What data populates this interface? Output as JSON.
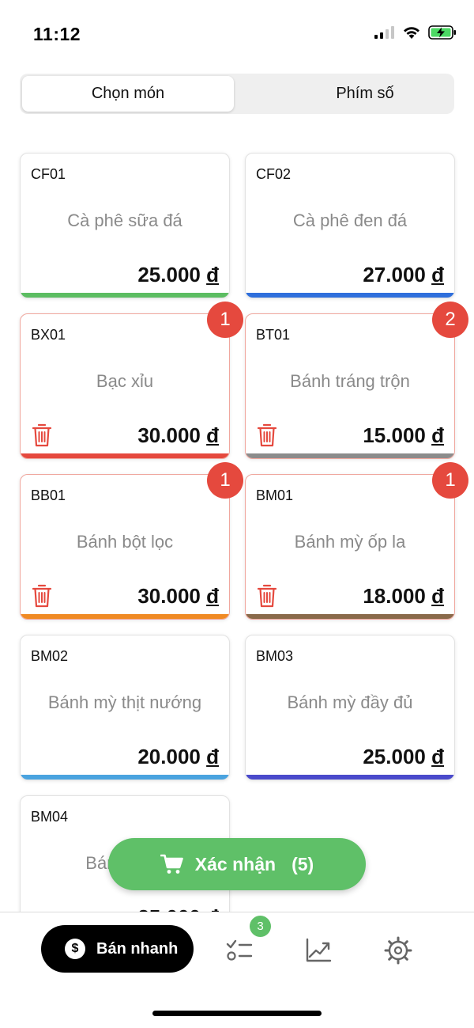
{
  "status_bar": {
    "time": "11:12"
  },
  "tabs": {
    "pick_item": "Chọn món",
    "numpad": "Phím số"
  },
  "products": [
    {
      "code": "CF01",
      "name": "Cà phê sữa đá",
      "price": "25.000",
      "currency": "đ",
      "bar_color": "#5cbd62",
      "qty": null
    },
    {
      "code": "CF02",
      "name": "Cà phê đen đá",
      "price": "27.000",
      "currency": "đ",
      "bar_color": "#2f6fdc",
      "qty": null
    },
    {
      "code": "BX01",
      "name": "Bạc xỉu",
      "price": "30.000",
      "currency": "đ",
      "bar_color": "#e5493e",
      "qty": "1"
    },
    {
      "code": "BT01",
      "name": "Bánh tráng trộn",
      "price": "15.000",
      "currency": "đ",
      "bar_color": "#8c8c8c",
      "qty": "2"
    },
    {
      "code": "BB01",
      "name": "Bánh bột lọc",
      "price": "30.000",
      "currency": "đ",
      "bar_color": "#f08a24",
      "qty": "1"
    },
    {
      "code": "BM01",
      "name": "Bánh mỳ ốp la",
      "price": "18.000",
      "currency": "đ",
      "bar_color": "#8a6a4a",
      "qty": "1"
    },
    {
      "code": "BM02",
      "name": "Bánh mỳ thịt nướng",
      "price": "20.000",
      "currency": "đ",
      "bar_color": "#4aa3df",
      "qty": null
    },
    {
      "code": "BM03",
      "name": "Bánh mỳ đầy đủ",
      "price": "25.000",
      "currency": "đ",
      "bar_color": "#4a4acb",
      "qty": null
    },
    {
      "code": "BM04",
      "name": "Bánh",
      "price": "25.000",
      "currency": "đ",
      "bar_color": "#e0e0e0",
      "qty": null
    }
  ],
  "confirm": {
    "label": "Xác nhận",
    "count": "(5)"
  },
  "nav": {
    "quick_sale": "Bán nhanh",
    "currency_symbol": "$",
    "orders_badge": "3"
  },
  "colors": {
    "accent_green": "#5fc068",
    "badge_red": "#e5493e"
  }
}
